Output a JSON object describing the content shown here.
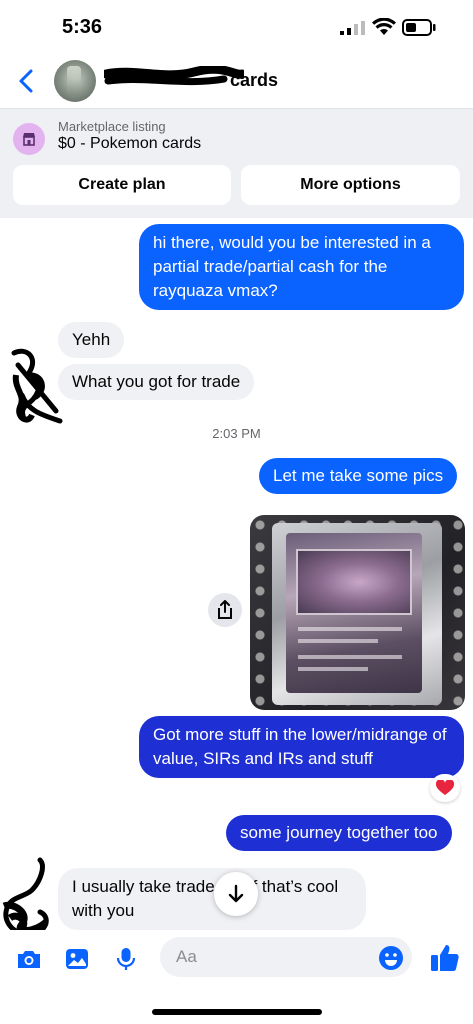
{
  "status": {
    "time": "5:36"
  },
  "header": {
    "name_visible": "cards"
  },
  "listing": {
    "caption": "Marketplace listing",
    "title": "$0 - Pokemon cards",
    "buttons": {
      "create_plan": "Create plan",
      "more_options": "More options"
    }
  },
  "messages": [
    {
      "from": "me",
      "text": "hi there, would you be interested in a partial trade/partial cash for the rayquaza vmax?"
    },
    {
      "from": "them",
      "text": "Yehh"
    },
    {
      "from": "them",
      "text": "What you got for trade"
    },
    {
      "from": "me",
      "text": "Let me take some pics"
    },
    {
      "from": "me",
      "text": "Got more stuff in the lower/midrange of value, SIRs and IRs and stuff"
    },
    {
      "from": "me",
      "text": "some journey together too"
    },
    {
      "from": "them",
      "text": "I usually take trade        0% if that’s cool with you"
    }
  ],
  "timestamp": "2:03 PM",
  "composer": {
    "placeholder": "Aa"
  },
  "colors": {
    "accent": "#0a62ff",
    "incoming_bg": "#f0f1f4",
    "listing_bg": "#eef0f3"
  },
  "icons": [
    "back-chevron-icon",
    "marketplace-shop-icon",
    "share-icon",
    "heart-reaction-icon",
    "arrow-down-icon",
    "camera-icon",
    "gallery-icon",
    "microphone-icon",
    "emoji-icon",
    "thumbs-up-icon"
  ]
}
